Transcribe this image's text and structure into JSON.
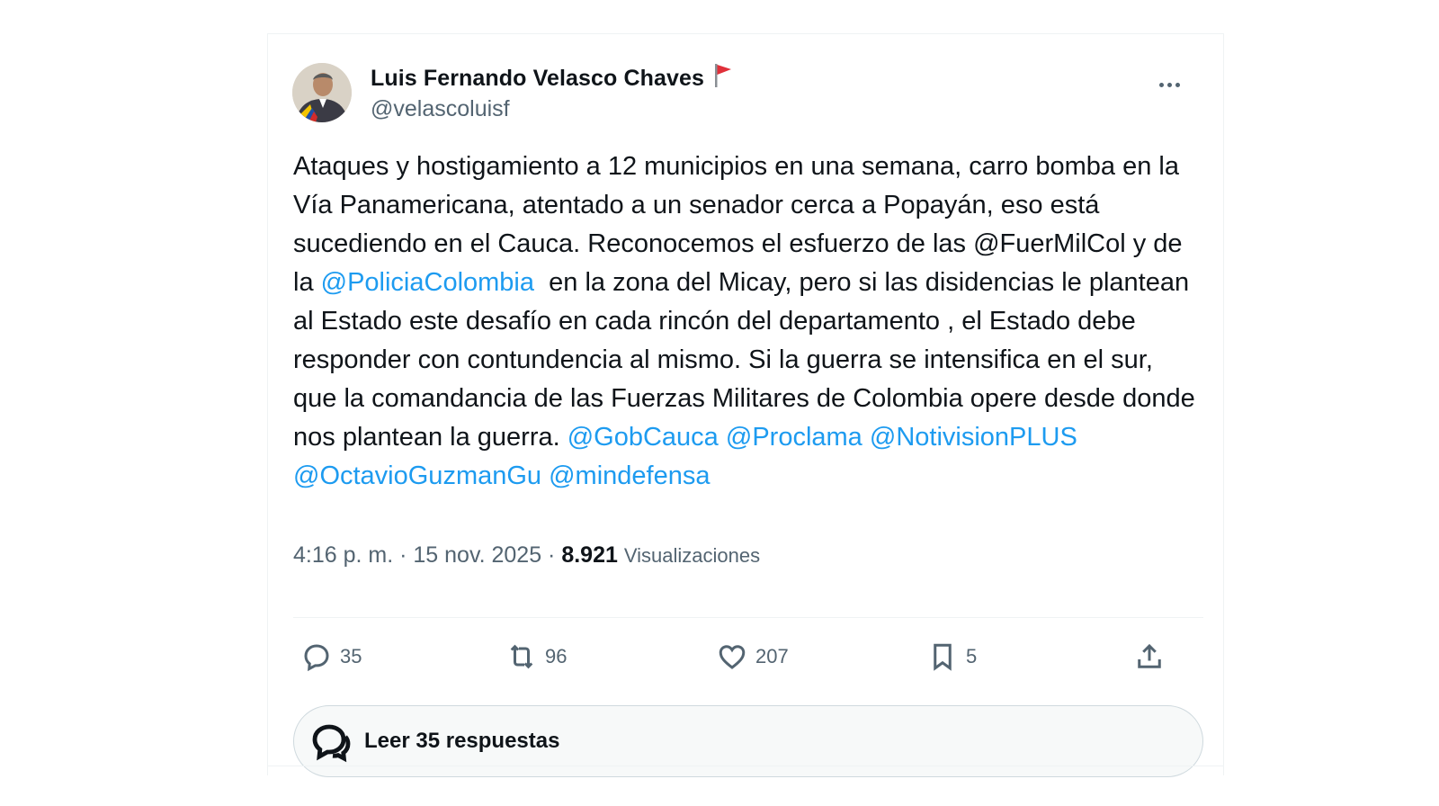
{
  "author": {
    "name": "Luis Fernando Velasco Chaves",
    "handle": "@velascoluisf",
    "flag_icon": "red-flag-emoji"
  },
  "tweet": {
    "segments": [
      {
        "text": "Ataques y hostigamiento a 12 municipios en una semana, carro bomba en la Vía Panamericana, atentado a un senador cerca a Popayán, eso está sucediendo en el Cauca. Reconocemos el esfuerzo de las @FuerMilCol y de la ",
        "mention": false
      },
      {
        "text": "@PoliciaColombia",
        "mention": true
      },
      {
        "text": "  en la zona del Micay, pero si las disidencias le plantean al Estado este desafío en cada rincón del departamento , el Estado debe responder con contundencia al mismo. Si la guerra se intensifica en el sur, que la comandancia de las Fuerzas Militares de Colombia opere desde donde nos plantean la guerra. ",
        "mention": false
      },
      {
        "text": "@GobCauca",
        "mention": true
      },
      {
        "text": " ",
        "mention": false
      },
      {
        "text": "@Proclama",
        "mention": true
      },
      {
        "text": " ",
        "mention": false
      },
      {
        "text": "@NotivisionPLUS",
        "mention": true
      },
      {
        "text": " ",
        "mention": false
      },
      {
        "text": "@OctavioGuzmanGu",
        "mention": true
      },
      {
        "text": " ",
        "mention": false
      },
      {
        "text": "@mindefensa",
        "mention": true
      }
    ]
  },
  "meta": {
    "time": "4:16 p. m.",
    "separator": " · ",
    "date": "15 nov. 2025",
    "views_count": "8.921",
    "views_label": "Visualizaciones"
  },
  "actions": {
    "replies": "35",
    "reposts": "96",
    "likes": "207",
    "bookmarks": "5"
  },
  "read_replies_label": "Leer 35 respuestas",
  "colors": {
    "mention": "#1d9bf0",
    "text": "#0f1419",
    "secondary": "#536471"
  }
}
